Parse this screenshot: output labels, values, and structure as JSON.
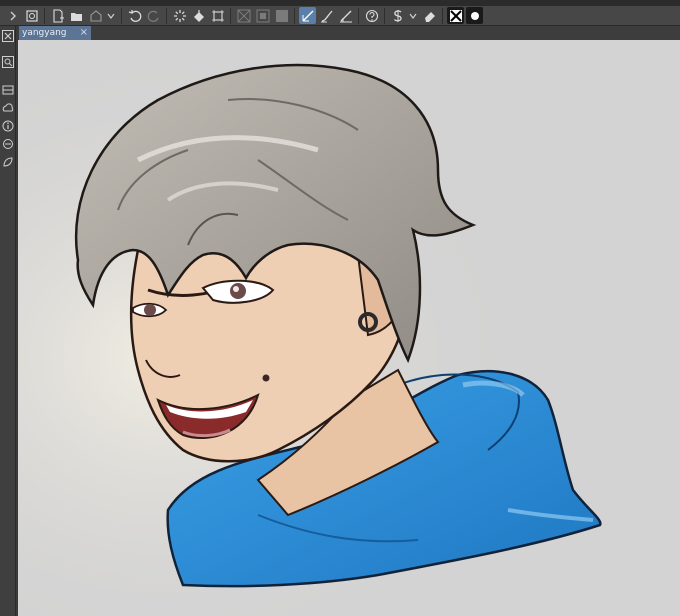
{
  "document_tab": {
    "title": "yangyang",
    "close_glyph": "×"
  },
  "toolbar": {
    "icons": [
      "new-icon",
      "open-icon",
      "save-icon",
      "undo-icon",
      "redo-icon",
      "loading-icon",
      "fill-icon",
      "transform-icon",
      "snap-icon",
      "ruler-icon",
      "layer-icon",
      "pen-icon",
      "brush-icon",
      "curve-icon",
      "help-icon",
      "dollar-icon",
      "eraser-icon",
      "color-swatch-icon",
      "circle-icon"
    ],
    "active_color": "#5a7fa8"
  },
  "left_sidebar": {
    "icons": [
      "close-panel-icon",
      "search-icon",
      "layers-icon",
      "cloud-icon",
      "info-icon",
      "settings-icon",
      "shape-icon"
    ]
  },
  "canvas": {
    "background_color": "#d3d3d3",
    "artwork": "anime-style-portrait"
  },
  "colors": {
    "ui_dark": "#3a3a3a",
    "toolbar": "#474747",
    "tab_active": "#5c7595",
    "hoodie": "#2f8fd8",
    "hair": "#aaa49d",
    "skin": "#efcfb3"
  }
}
